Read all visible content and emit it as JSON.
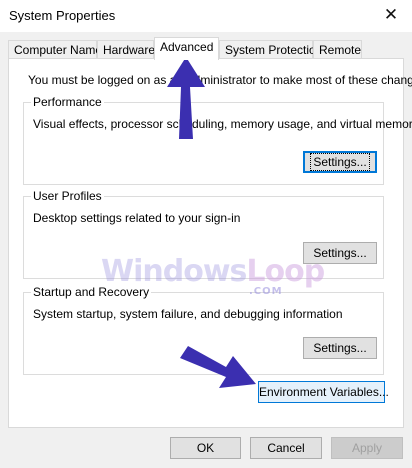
{
  "window": {
    "title": "System Properties",
    "close_glyph": "✕"
  },
  "tabs": [
    {
      "label": "Computer Name",
      "active": false
    },
    {
      "label": "Hardware",
      "active": false
    },
    {
      "label": "Advanced",
      "active": true
    },
    {
      "label": "System Protection",
      "active": false
    },
    {
      "label": "Remote",
      "active": false
    }
  ],
  "advanced": {
    "notice": "You must be logged on as an Administrator to make most of these changes.",
    "performance": {
      "legend": "Performance",
      "description": "Visual effects, processor scheduling, memory usage, and virtual memory",
      "button": "Settings..."
    },
    "user_profiles": {
      "legend": "User Profiles",
      "description": "Desktop settings related to your sign-in",
      "button": "Settings..."
    },
    "startup_recovery": {
      "legend": "Startup and Recovery",
      "description": "System startup, system failure, and debugging information",
      "button": "Settings..."
    },
    "env_button": "Environment Variables..."
  },
  "footer": {
    "ok": "OK",
    "cancel": "Cancel",
    "apply": "Apply"
  },
  "watermark": {
    "windows": "Windows",
    "loop": "Loop",
    "com": ".COM"
  },
  "colors": {
    "accent_blue": "#0078d7",
    "arrow": "#3b2fb0"
  },
  "icons": [
    "close-icon",
    "pointer-arrow-icon"
  ]
}
